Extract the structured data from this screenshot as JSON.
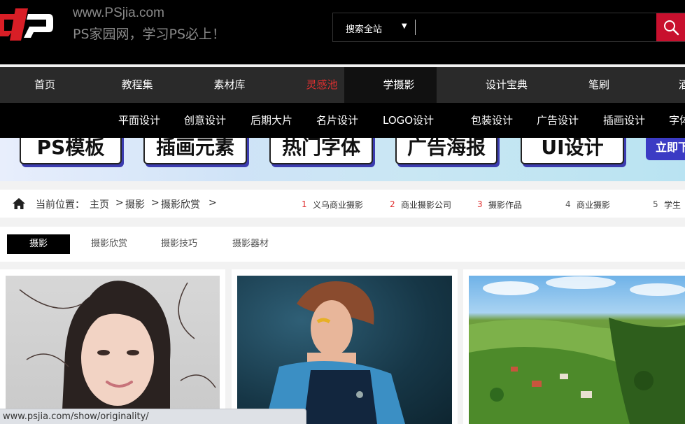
{
  "header": {
    "site_url": "www.PSjia.com",
    "slogan": "PS家园网，学习PS必上！",
    "search": {
      "scope": "搜索全站",
      "value": ""
    }
  },
  "nav": {
    "items": [
      {
        "label": "首页"
      },
      {
        "label": "教程集"
      },
      {
        "label": "素材库"
      },
      {
        "label": "灵感池"
      },
      {
        "label": "学摄影"
      },
      {
        "label": "设计宝典"
      },
      {
        "label": "笔刷"
      },
      {
        "label": "酒"
      }
    ]
  },
  "subnav": {
    "items": [
      {
        "label": "平面设计"
      },
      {
        "label": "创意设计"
      },
      {
        "label": "后期大片"
      },
      {
        "label": "名片设计"
      },
      {
        "label": "LOGO设计"
      },
      {
        "label": "包装设计"
      },
      {
        "label": "广告设计"
      },
      {
        "label": "插画设计"
      },
      {
        "label": "字体"
      }
    ]
  },
  "banner": {
    "tags": [
      "PS模板",
      "插画元素",
      "热门字体",
      "广告海报",
      "UI设计"
    ],
    "cta": "立即下"
  },
  "breadcrumb": {
    "prefix": "当前位置：",
    "items": [
      "主页",
      "摄影",
      "摄影欣赏"
    ],
    "separator": ">"
  },
  "hot_searches": [
    {
      "rank": "1",
      "label": "义乌商业摄影"
    },
    {
      "rank": "2",
      "label": "商业摄影公司"
    },
    {
      "rank": "3",
      "label": "摄影作品"
    },
    {
      "rank": "4",
      "label": "商业摄影"
    },
    {
      "rank": "5",
      "label": "学生"
    }
  ],
  "category_tabs": [
    {
      "label": "摄影"
    },
    {
      "label": "摄影欣赏"
    },
    {
      "label": "摄影技巧"
    },
    {
      "label": "摄影器材"
    }
  ],
  "status_bar": {
    "url": "www.psjia.com/show/originality/"
  },
  "colors": {
    "accent_red": "#c8102e",
    "nav_highlight": "#e03030",
    "rank_top": "#e03030",
    "rank_normal": "#555555"
  }
}
